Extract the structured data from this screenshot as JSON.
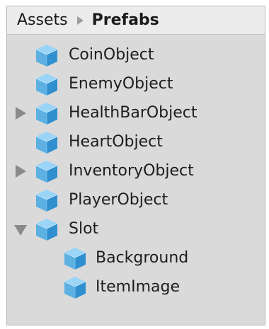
{
  "breadcrumb": {
    "root": "Assets",
    "current": "Prefabs"
  },
  "icons": {
    "separator": "breadcrumb-arrow-icon",
    "prefab": "prefab-cube-icon",
    "collapsed": "foldout-collapsed-icon",
    "expanded": "foldout-expanded-icon"
  },
  "colors": {
    "panel_background": "#dadada",
    "header_background": "#ececec",
    "prefab_icon": "#4fa8dc"
  },
  "tree": {
    "items": [
      {
        "label": "CoinObject"
      },
      {
        "label": "EnemyObject"
      },
      {
        "label": "HealthBarObject",
        "foldout": "collapsed"
      },
      {
        "label": "HeartObject"
      },
      {
        "label": "InventoryObject",
        "foldout": "collapsed"
      },
      {
        "label": "PlayerObject"
      },
      {
        "label": "Slot",
        "foldout": "expanded"
      },
      {
        "label": "Background",
        "parent": "Slot"
      },
      {
        "label": "ItemImage",
        "parent": "Slot"
      }
    ]
  }
}
